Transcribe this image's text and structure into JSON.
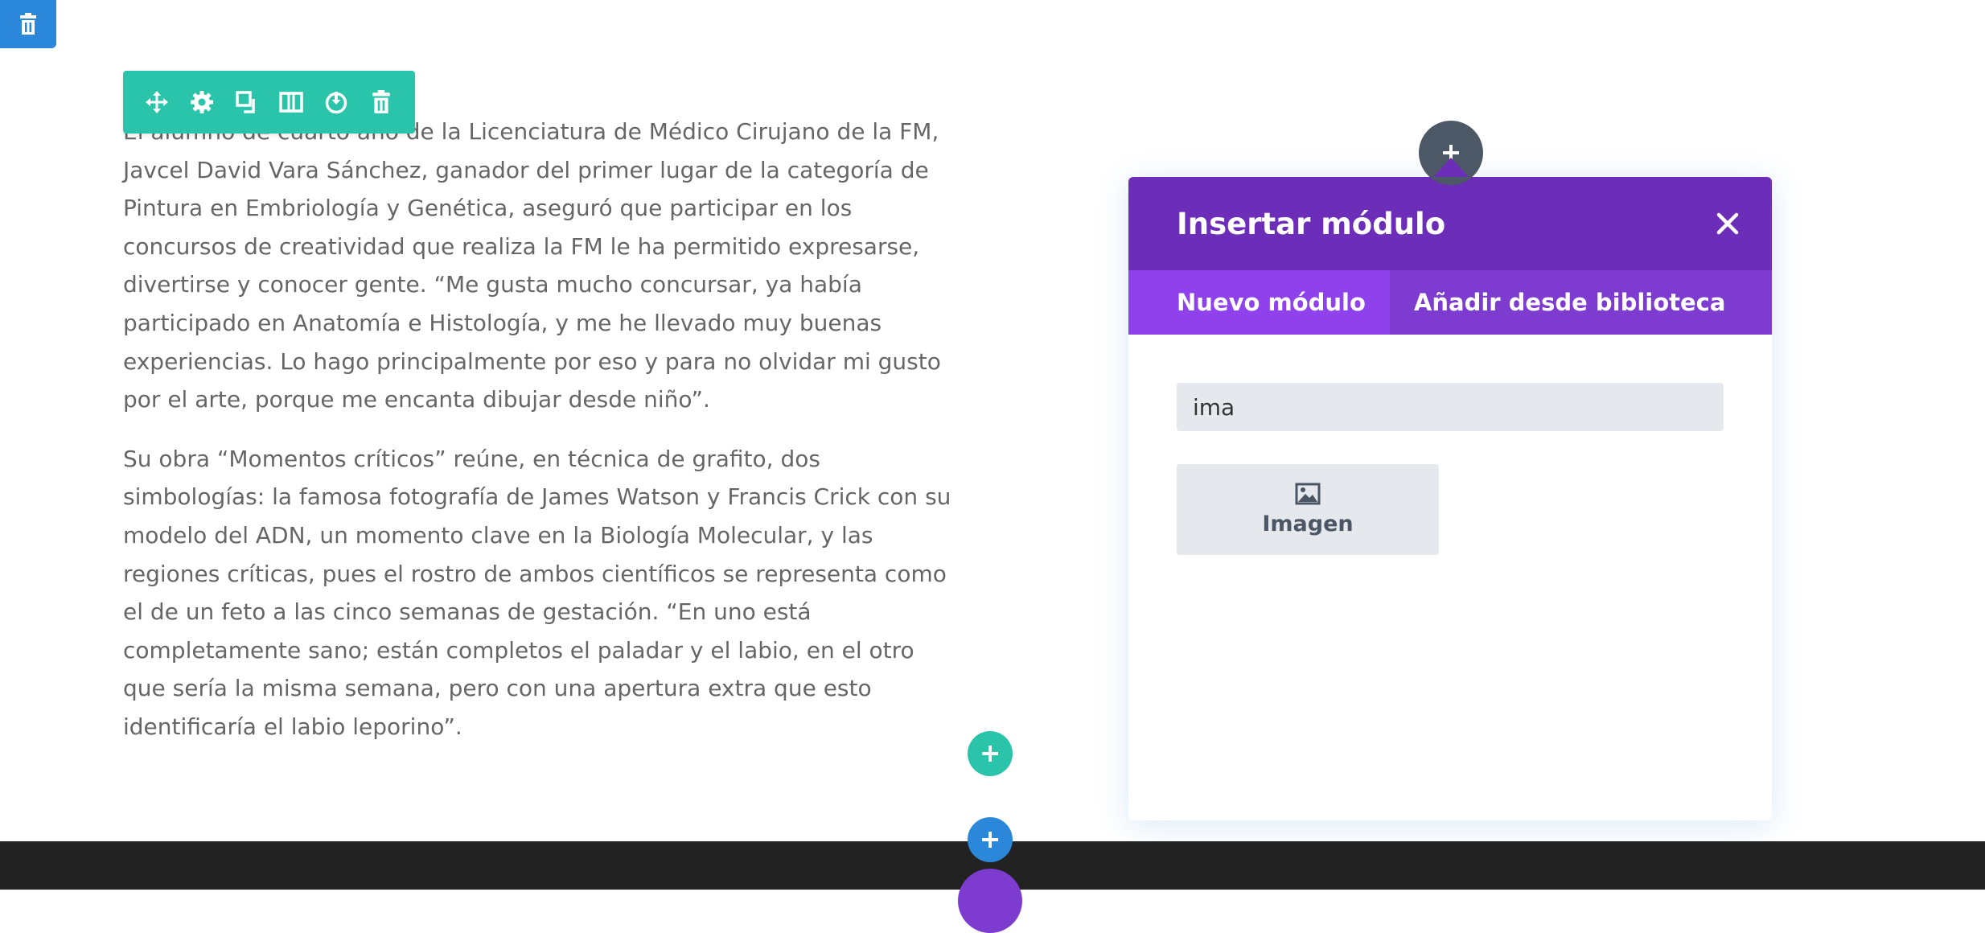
{
  "toolbar": {
    "icons": [
      "move-icon",
      "gear-icon",
      "duplicate-icon",
      "columns-icon",
      "save-icon",
      "trash-icon"
    ]
  },
  "article": {
    "paragraphs": [
      "El alumno de cuarto año de la Licenciatura de Médico Cirujano de la FM, Javcel David Vara Sánchez, ganador del primer lugar de la categoría de Pintura en Embriología y Genética, aseguró que participar en los concursos de creatividad que realiza la FM le ha permitido expresarse, divertirse y conocer gente. “Me gusta mucho concursar, ya había participado en Anatomía e Histología, y me he llevado muy buenas experiencias. Lo hago principalmente por eso y para no olvidar mi gusto por el arte, porque me encanta dibujar desde niño”.",
      "Su obra “Momentos críticos” reúne, en técnica de grafito, dos simbologías: la famosa fotografía de James Watson y Francis Crick con su modelo del ADN, un momento clave en la Biología Molecular, y las regiones críticas, pues el rostro de ambos científicos se representa como el de un feto a las cinco semanas de gestación. “En uno está completamente sano; están completos el paladar y el labio, en el otro que sería la misma semana, pero con una apertura extra que esto identificaría el labio leporino”."
    ]
  },
  "modal": {
    "title": "Insertar módulo",
    "tabs": [
      {
        "label": "Nuevo módulo",
        "active": true
      },
      {
        "label": "Añadir desde biblioteca",
        "active": false
      }
    ],
    "search_value": "ima",
    "results": [
      {
        "label": "Imagen",
        "icon": "image-icon"
      }
    ]
  },
  "colors": {
    "teal": "#29c4a9",
    "purple_dark": "#6c2eb9",
    "purple_tab": "#7e3bd0",
    "purple_active": "#8f42ec",
    "blue": "#2b87da",
    "slate": "#4c5866"
  }
}
